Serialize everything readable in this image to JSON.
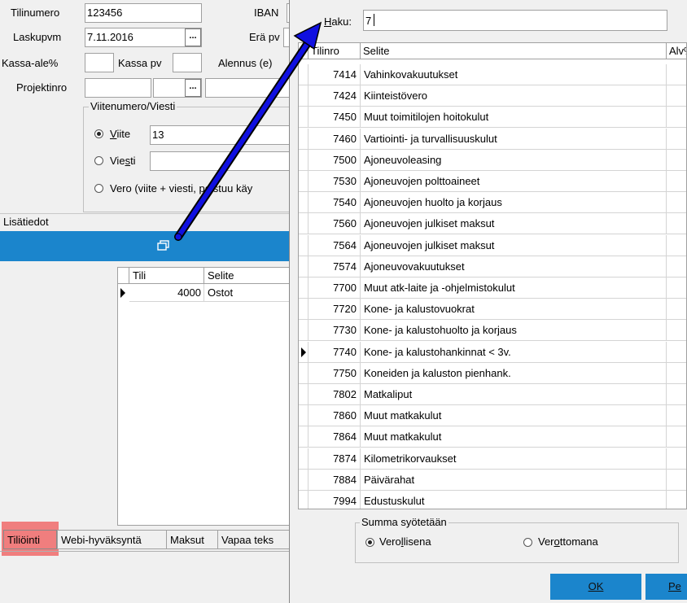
{
  "form": {
    "tilinumero_label": "Tilinumero",
    "tilinumero_value": "123456",
    "iban_label": "IBAN",
    "laskupvm_label": "Laskupvm",
    "laskupvm_value": "7.11.2016",
    "era_label": "Erä pv",
    "kassa_ale_label": "Kassa-ale%",
    "kassa_pv_label": "Kassa pv",
    "alennus_label": "Alennus (e)",
    "projektinro_label": "Projektinro",
    "dots": "..."
  },
  "viite_group": {
    "caption": "Viitenumero/Viesti",
    "viite_label": "Viite",
    "viite_value": "13",
    "viesti_label": "Viesti",
    "vero_label": "Vero (viite + viesti, poistuu käy"
  },
  "lisatiedot": {
    "label": "Lisätiedot"
  },
  "left_grid": {
    "headers": [
      "Tili",
      "Selite"
    ],
    "rows": [
      {
        "tili": "4000",
        "selite": "Ostot"
      }
    ]
  },
  "tabs": [
    "Tiliöinti",
    "Webi-hyväksyntä",
    "Maksut",
    "Vapaa teks"
  ],
  "dialog": {
    "haku_label": "Haku:",
    "haku_value": "7",
    "headers": [
      "Tilinro",
      "Selite",
      "Alv%"
    ],
    "rows": [
      {
        "tilinro": "7414",
        "selite": "Vahinkovakuutukset"
      },
      {
        "tilinro": "7424",
        "selite": "Kiinteistövero"
      },
      {
        "tilinro": "7450",
        "selite": "Muut toimitilojen hoitokulut"
      },
      {
        "tilinro": "7460",
        "selite": "Vartiointi- ja turvallisuuskulut"
      },
      {
        "tilinro": "7500",
        "selite": "Ajoneuvoleasing"
      },
      {
        "tilinro": "7530",
        "selite": "Ajoneuvojen polttoaineet"
      },
      {
        "tilinro": "7540",
        "selite": "Ajoneuvojen huolto ja korjaus"
      },
      {
        "tilinro": "7560",
        "selite": "Ajoneuvojen julkiset maksut"
      },
      {
        "tilinro": "7564",
        "selite": "Ajoneuvojen julkiset maksut"
      },
      {
        "tilinro": "7574",
        "selite": "Ajoneuvovakuutukset"
      },
      {
        "tilinro": "7700",
        "selite": "Muut atk-laite ja -ohjelmistokulut"
      },
      {
        "tilinro": "7720",
        "selite": "Kone- ja kalustovuokrat"
      },
      {
        "tilinro": "7730",
        "selite": "Kone- ja kalustohuolto ja korjaus"
      },
      {
        "tilinro": "7740",
        "selite": "Kone- ja kalustohankinnat < 3v."
      },
      {
        "tilinro": "7750",
        "selite": "Koneiden ja kaluston pienhank."
      },
      {
        "tilinro": "7802",
        "selite": "Matkaliput"
      },
      {
        "tilinro": "7860",
        "selite": "Muut matkakulut"
      },
      {
        "tilinro": "7864",
        "selite": "Muut matkakulut"
      },
      {
        "tilinro": "7874",
        "selite": "Kilometrikorvaukset"
      },
      {
        "tilinro": "7884",
        "selite": "Päivärahat"
      },
      {
        "tilinro": "7994",
        "selite": "Edustuskulut"
      }
    ],
    "selected_row_index": 13,
    "summa_caption": "Summa syötetään",
    "verollisena": "Verollisena",
    "verottomana": "Verottomana",
    "ok": "OK",
    "peruuta": "Pe"
  },
  "colors": {
    "accent_bar": "#1b85cc",
    "arrow": "#1010e0",
    "ok_button": "#1b85cc",
    "highlight": "#f06a6a"
  }
}
